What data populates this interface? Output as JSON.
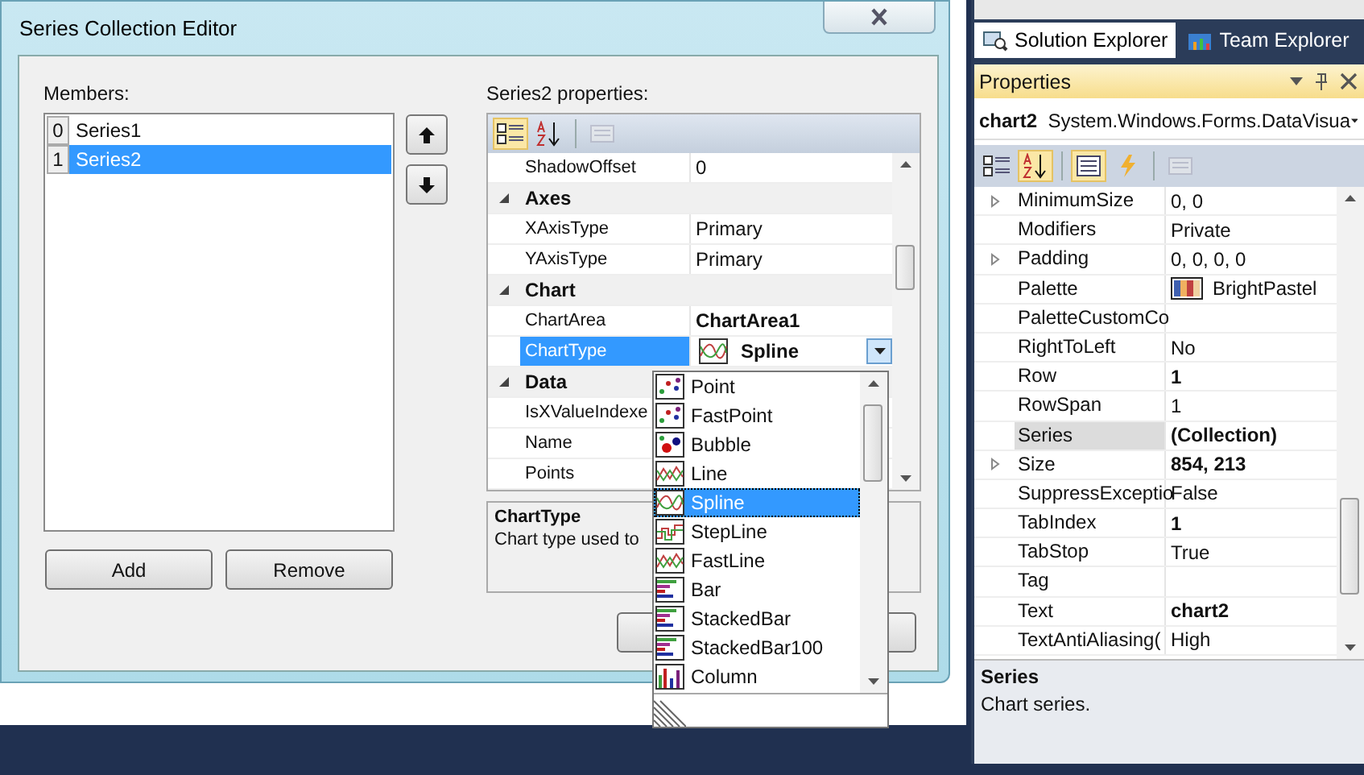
{
  "dialog": {
    "title": "Series Collection Editor",
    "members_label": "Members:",
    "members": [
      {
        "index": "0",
        "name": "Series1",
        "selected": false
      },
      {
        "index": "1",
        "name": "Series2",
        "selected": true
      }
    ],
    "buttons": [
      "Add",
      "Remove"
    ],
    "properties_label": "Series2 properties:",
    "grid_rows": [
      {
        "kind": "property",
        "name": "ShadowOffset",
        "value": "0",
        "bold": false,
        "selected": false
      },
      {
        "kind": "category",
        "name": "Axes",
        "expanded": true
      },
      {
        "kind": "property",
        "name": "XAxisType",
        "value": "Primary",
        "bold": false,
        "selected": false
      },
      {
        "kind": "property",
        "name": "YAxisType",
        "value": "Primary",
        "bold": false,
        "selected": false
      },
      {
        "kind": "category",
        "name": "Chart",
        "expanded": true
      },
      {
        "kind": "property",
        "name": "ChartArea",
        "value": "ChartArea1",
        "bold": true,
        "selected": false
      },
      {
        "kind": "choice",
        "name": "ChartType",
        "value": "Spline",
        "bold": true,
        "selected": true
      },
      {
        "kind": "category",
        "name": "Data",
        "expanded": true
      },
      {
        "kind": "property",
        "name": "IsXValueIndexe",
        "selected": false
      },
      {
        "kind": "property",
        "name": "Name",
        "selected": false
      },
      {
        "kind": "property",
        "name": "Points",
        "selected": false
      }
    ],
    "description": {
      "title": "ChartType",
      "text": "Chart type used to"
    }
  },
  "dropdown": {
    "items": [
      {
        "label": "Point",
        "kind": "point",
        "selected": false
      },
      {
        "label": "FastPoint",
        "kind": "point",
        "selected": false
      },
      {
        "label": "Bubble",
        "kind": "bubble",
        "selected": false
      },
      {
        "label": "Line",
        "kind": "line",
        "selected": false
      },
      {
        "label": "Spline",
        "kind": "spline",
        "selected": true
      },
      {
        "label": "StepLine",
        "kind": "step",
        "selected": false
      },
      {
        "label": "FastLine",
        "kind": "line",
        "selected": false
      },
      {
        "label": "Bar",
        "kind": "bar",
        "selected": false
      },
      {
        "label": "StackedBar",
        "kind": "bar",
        "selected": false
      },
      {
        "label": "StackedBar100",
        "kind": "bar",
        "selected": false
      },
      {
        "label": "Column",
        "kind": "column",
        "selected": false
      }
    ]
  },
  "ide": {
    "tabs": [
      {
        "label": "Solution Explorer",
        "selected": true
      },
      {
        "label": "Team Explorer",
        "selected": false
      }
    ],
    "properties": {
      "title": "Properties",
      "object_name": "chart2",
      "object_type": "System.Windows.Forms.DataVisua",
      "rows": [
        {
          "kind": "property",
          "name": "MinimumSize",
          "value": "0, 0",
          "bold": false,
          "selected": false,
          "expandable": true
        },
        {
          "kind": "property",
          "name": "Modifiers",
          "value": "Private",
          "bold": false,
          "selected": false,
          "expandable": false
        },
        {
          "kind": "property",
          "name": "Padding",
          "value": "0, 0, 0, 0",
          "bold": false,
          "selected": false,
          "expandable": true
        },
        {
          "kind": "palette",
          "name": "Palette",
          "value": "BrightPastel",
          "bold": false,
          "selected": false,
          "expandable": false
        },
        {
          "kind": "property",
          "name": "PaletteCustomCo",
          "selected": false,
          "expandable": false
        },
        {
          "kind": "property",
          "name": "RightToLeft",
          "value": "No",
          "bold": false,
          "selected": false,
          "expandable": false
        },
        {
          "kind": "property",
          "name": "Row",
          "value": "1",
          "bold": true,
          "selected": false,
          "expandable": false
        },
        {
          "kind": "property",
          "name": "RowSpan",
          "value": "1",
          "bold": false,
          "selected": false,
          "expandable": false
        },
        {
          "kind": "property",
          "name": "Series",
          "value": "(Collection)",
          "bold": true,
          "selected": true,
          "expandable": false
        },
        {
          "kind": "property",
          "name": "Size",
          "value": "854, 213",
          "bold": true,
          "selected": false,
          "expandable": true
        },
        {
          "kind": "property",
          "name": "SuppressExceptio",
          "value": "False",
          "bold": false,
          "selected": false,
          "expandable": false
        },
        {
          "kind": "property",
          "name": "TabIndex",
          "value": "1",
          "bold": true,
          "selected": false,
          "expandable": false
        },
        {
          "kind": "property",
          "name": "TabStop",
          "value": "True",
          "bold": false,
          "selected": false,
          "expandable": false
        },
        {
          "kind": "property",
          "name": "Tag",
          "selected": false,
          "expandable": false
        },
        {
          "kind": "property",
          "name": "Text",
          "value": "chart2",
          "bold": true,
          "selected": false,
          "expandable": false
        },
        {
          "kind": "property",
          "name": "TextAntiAliasing(",
          "value": "High",
          "bold": false,
          "selected": false,
          "expandable": false
        }
      ],
      "description": {
        "title": "Series",
        "text": "Chart series."
      }
    }
  }
}
